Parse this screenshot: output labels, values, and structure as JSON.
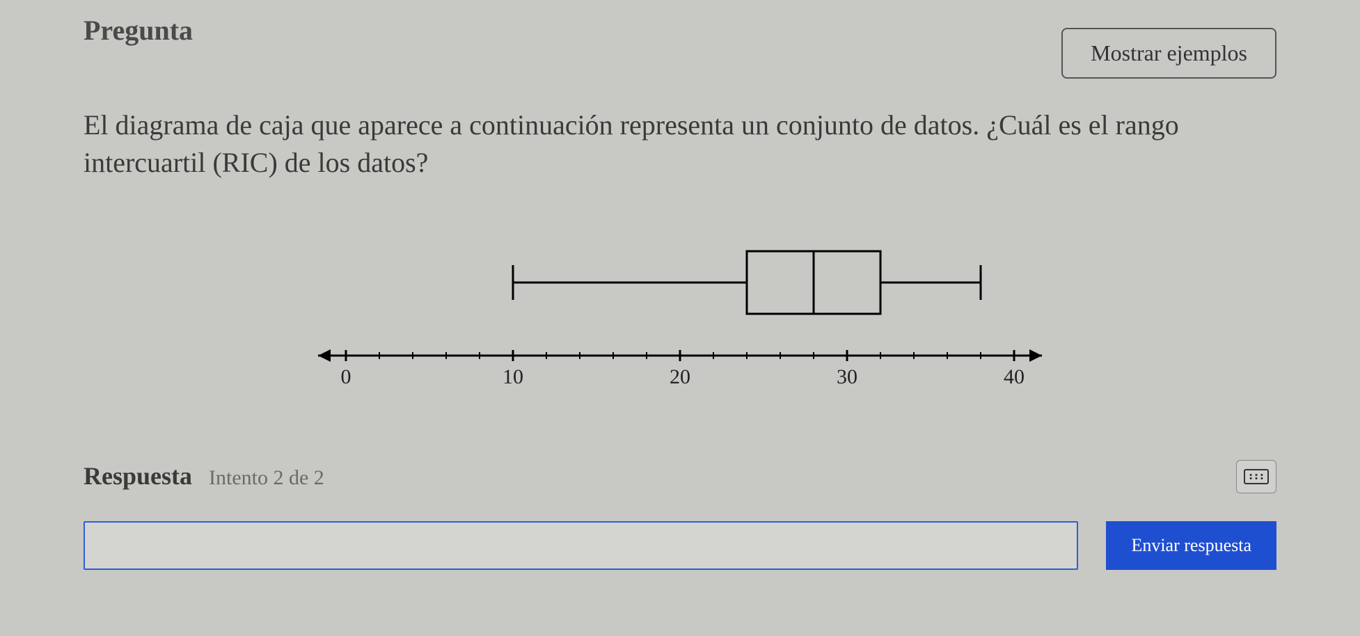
{
  "header": {
    "question_label": "Pregunta",
    "examples_label": "Mostrar ejemplos"
  },
  "prompt": "El diagrama de caja que aparece a continuación representa un conjunto de datos. ¿Cuál es el rango intercuartil (RIC) de los datos?",
  "chart_data": {
    "type": "boxplot",
    "axis": {
      "min": 0,
      "max": 40,
      "major_step": 10,
      "minor_step": 2,
      "tick_labels": [
        0,
        10,
        20,
        30,
        40
      ]
    },
    "boxplot": {
      "min": 10,
      "q1": 24,
      "median": 28,
      "q3": 32,
      "max": 38
    },
    "title": "",
    "xlabel": "",
    "ylabel": ""
  },
  "answer": {
    "label": "Respuesta",
    "attempt_text": "Intento 2 de 2",
    "input_value": "",
    "submit_label": "Enviar respuesta"
  }
}
